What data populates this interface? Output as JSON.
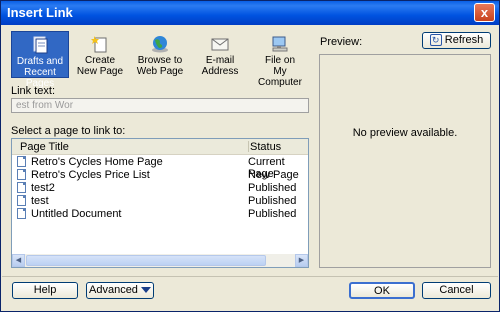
{
  "window": {
    "title": "Insert Link",
    "close_label": "x"
  },
  "toolbar": {
    "items": [
      {
        "line1": "Drafts and",
        "line2": "Recent Pages",
        "icon": "drafts-icon",
        "selected": true
      },
      {
        "line1": "Create",
        "line2": "New Page",
        "icon": "new-page-icon",
        "selected": false
      },
      {
        "line1": "Browse to",
        "line2": "Web Page",
        "icon": "globe-icon",
        "selected": false
      },
      {
        "line1": "E-mail",
        "line2": "Address",
        "icon": "email-icon",
        "selected": false
      },
      {
        "line1": "File on",
        "line2": "My Computer",
        "icon": "computer-icon",
        "selected": false
      }
    ]
  },
  "link_text": {
    "label": "Link text:",
    "value": "est from Wor"
  },
  "page_list": {
    "label": "Select a page to link to:",
    "col_title": "Page Title",
    "col_status": "Status",
    "rows": [
      {
        "title": "Retro's Cycles Home Page",
        "status": "Current Page"
      },
      {
        "title": "Retro's Cycles Price List",
        "status": "New Page"
      },
      {
        "title": "test2",
        "status": "Published"
      },
      {
        "title": "test",
        "status": "Published"
      },
      {
        "title": "Untitled Document",
        "status": "Published"
      }
    ]
  },
  "preview": {
    "label": "Preview:",
    "refresh_label": "Refresh",
    "empty_text": "No preview available."
  },
  "footer": {
    "help": "Help",
    "advanced": "Advanced",
    "ok": "OK",
    "cancel": "Cancel"
  }
}
